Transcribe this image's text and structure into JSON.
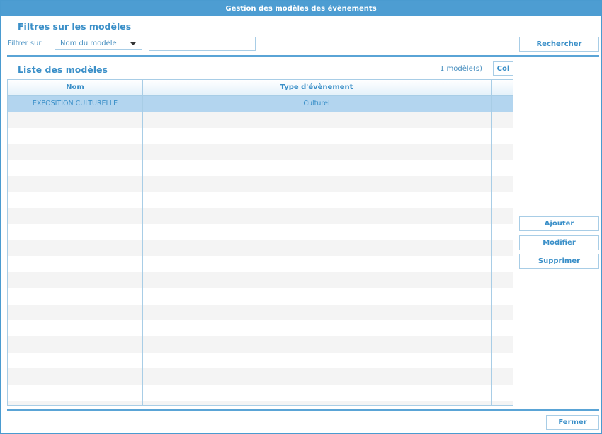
{
  "window": {
    "title": "Gestion des modèles des évènements"
  },
  "filters": {
    "section_title": "Filtres sur les modèles",
    "filter_label": "Filtrer sur",
    "field_select": "Nom du modèle",
    "search_value": "",
    "search_button": "Rechercher"
  },
  "list": {
    "section_title": "Liste des modèles",
    "count": "1 modèle(s)",
    "col_button": "Col",
    "columns": {
      "name": "Nom",
      "type": "Type d'évènement"
    },
    "rows": [
      {
        "name": "EXPOSITION CULTURELLE",
        "type": "Culturel"
      }
    ]
  },
  "actions": {
    "add": "Ajouter",
    "edit": "Modifier",
    "delete": "Supprimer"
  },
  "footer": {
    "close": "Fermer"
  }
}
